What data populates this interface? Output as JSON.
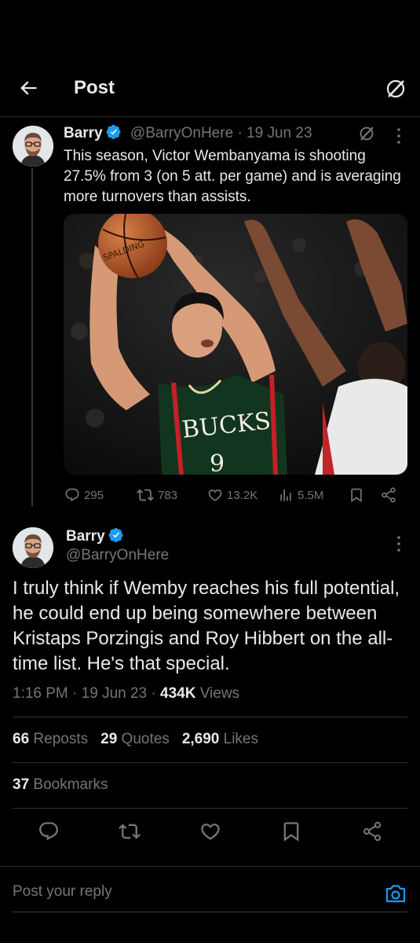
{
  "header": {
    "title": "Post"
  },
  "quoted_post": {
    "author_name": "Barry",
    "handle": "@BarryOnHere",
    "date": "19 Jun 23",
    "separator": "·",
    "text": "This season, Victor Wembanyama is shooting 27.5% from 3 (on 5 att. per game) and is averaging more turnovers than assists.",
    "jersey_text": "BUCKS",
    "jersey_number": "9",
    "ball_text": "SPALDING",
    "counts": {
      "replies": "295",
      "reposts": "783",
      "likes": "13.2K",
      "views": "5.5M"
    }
  },
  "main_post": {
    "author_name": "Barry",
    "handle": "@BarryOnHere",
    "text": "I truly think if Wemby reaches his full potential, he could end up being somewhere between Kristaps Porzingis and Roy Hibbert on the all-time list. He's that special.",
    "time": "1:16 PM",
    "date": "19 Jun 23",
    "separator": "·",
    "views_count": "434K",
    "views_label": "Views"
  },
  "stats": {
    "reposts_count": "66",
    "reposts_label": "Reposts",
    "quotes_count": "29",
    "quotes_label": "Quotes",
    "likes_count": "2,690",
    "likes_label": "Likes",
    "bookmarks_count": "37",
    "bookmarks_label": "Bookmarks"
  },
  "reply": {
    "placeholder": "Post your reply"
  },
  "colors": {
    "background": "#000000",
    "text": "#e7e9ea",
    "muted": "#71767b",
    "accent": "#1d9bf0",
    "divider": "#2f3336"
  },
  "icons": [
    "back-arrow-icon",
    "grok-icon",
    "verified-badge-icon",
    "more-icon",
    "reply-icon",
    "repost-icon",
    "like-icon",
    "views-icon",
    "bookmark-icon",
    "share-icon",
    "camera-icon"
  ]
}
